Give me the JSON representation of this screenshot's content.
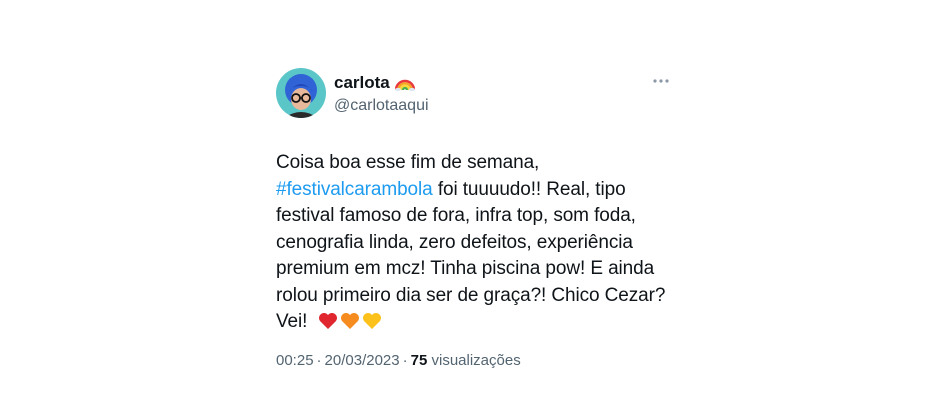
{
  "user": {
    "display_name": "carlota",
    "name_emoji": "rainbow-emoji",
    "handle": "@carlotaaqui",
    "avatar": "avatar-photo"
  },
  "tweet": {
    "lines": [
      [
        "Coisa boa esse fim de semana,"
      ],
      [
        "",
        "foi tuuuudo!! Real, tipo"
      ],
      [
        "festival famoso de fora, infra top, som foda,"
      ],
      [
        "cenografia linda, zero defeitos, experiência"
      ],
      [
        "premium em mcz! Tinha piscina pow! E ainda"
      ],
      [
        "rolou primeiro dia ser de graça?! Chico Cezar?"
      ],
      [
        "Vei!"
      ]
    ],
    "hashtag": "#festivalcarambola",
    "hashtag_color": "#1d9bf0",
    "end_emojis": [
      "red-heart-emoji",
      "orange-heart-emoji",
      "yellow-heart-emoji"
    ]
  },
  "meta": {
    "time": "00:25",
    "date": "20/03/2023",
    "separator": "·",
    "views_count": "75",
    "views_label": "visualizações"
  },
  "icons": {
    "more": "more-options-icon"
  }
}
